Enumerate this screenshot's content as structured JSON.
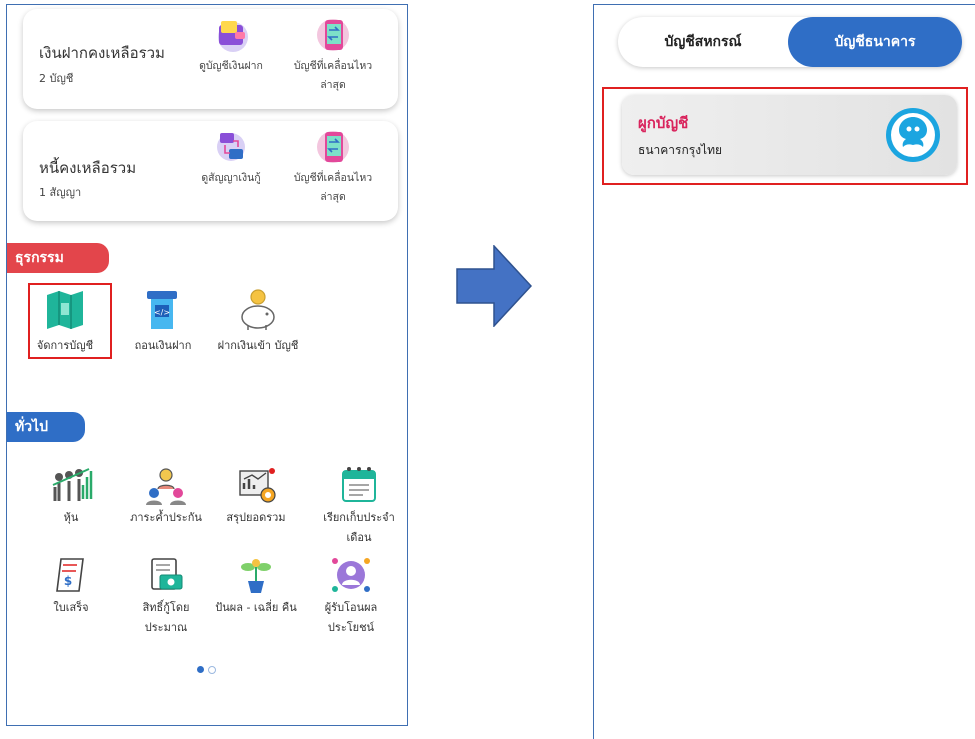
{
  "left_screen": {
    "cards": [
      {
        "title": "เงินฝากคงเหลือรวม",
        "subtitle": "2 บัญชี",
        "actions": [
          {
            "label": "ดูบัญชีเงินฝาก",
            "icon": "wallet-icon"
          },
          {
            "label": "บัญชีที่เคลื่อนไหว ล่าสุด",
            "icon": "mobile-transfer-icon"
          }
        ]
      },
      {
        "title": "หนี้คงเหลือรวม",
        "subtitle": "1 สัญญา",
        "actions": [
          {
            "label": "ดูสัญญาเงินกู้",
            "icon": "loan-transfer-icon"
          },
          {
            "label": "บัญชีที่เคลื่อนไหว ล่าสุด",
            "icon": "mobile-transfer-icon"
          }
        ]
      }
    ],
    "sections": {
      "transactions": {
        "title": "ธุรกรรม",
        "items": [
          {
            "label": "จัดการบัญชี",
            "icon": "book-icon",
            "highlighted": true
          },
          {
            "label": "ถอนเงินฝาก",
            "icon": "atm-icon"
          },
          {
            "label": "ฝากเงินเข้า บัญชี",
            "icon": "piggy-bank-icon"
          }
        ]
      },
      "general": {
        "title": "ทั่วไป",
        "items": [
          {
            "label": "หุ้น",
            "icon": "stock-growth-icon"
          },
          {
            "label": "ภาระค้ำประกัน",
            "icon": "guarantor-icon"
          },
          {
            "label": "สรุปยอดรวม",
            "icon": "summary-chart-icon"
          },
          {
            "label": "เรียกเก็บประจำ เดือน",
            "icon": "calendar-icon"
          },
          {
            "label": "ใบเสร็จ",
            "icon": "receipt-icon"
          },
          {
            "label": "สิทธิ์กู้โดย ประมาณ",
            "icon": "loan-rights-icon"
          },
          {
            "label": "ปันผล - เฉลี่ย คืน",
            "icon": "dividend-plant-icon"
          },
          {
            "label": "ผู้รับโอนผล ประโยชน์",
            "icon": "beneficiary-icon"
          }
        ]
      }
    },
    "pagination": {
      "pages": 2,
      "active": 1
    }
  },
  "right_screen": {
    "tabs": [
      {
        "label": "บัญชีสหกรณ์",
        "active": false
      },
      {
        "label": "บัญชีธนาคาร",
        "active": true
      }
    ],
    "bank_card": {
      "action_label": "ผูกบัญชี",
      "bank_name": "ธนาคารกรุงไทย",
      "logo_icon": "krungthai-bank-logo-icon"
    }
  },
  "colors": {
    "accent_blue": "#2f6ec6",
    "section_red": "#e3454b",
    "highlight_red": "#e02020",
    "link_pink": "#d9245d",
    "arrow_blue": "#4472c4"
  }
}
